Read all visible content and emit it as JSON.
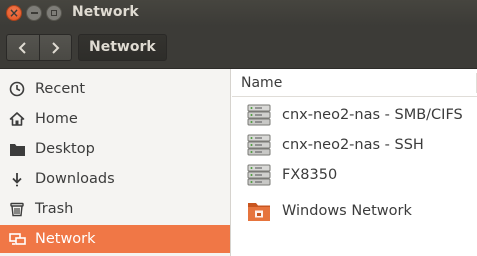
{
  "window": {
    "title": "Network"
  },
  "toolbar": {
    "path_label": "Network"
  },
  "sidebar": {
    "items": [
      {
        "label": "Recent",
        "icon": "clock-icon"
      },
      {
        "label": "Home",
        "icon": "home-icon"
      },
      {
        "label": "Desktop",
        "icon": "folder-icon"
      },
      {
        "label": "Downloads",
        "icon": "download-icon"
      },
      {
        "label": "Trash",
        "icon": "trash-icon"
      },
      {
        "label": "Network",
        "icon": "network-icon",
        "active": true
      }
    ]
  },
  "main": {
    "column_header": "Name",
    "items": [
      {
        "label": "cnx-neo2-nas - SMB/CIFS",
        "icon": "server-icon"
      },
      {
        "label": "cnx-neo2-nas - SSH",
        "icon": "server-icon"
      },
      {
        "label": "FX8350",
        "icon": "server-icon"
      },
      {
        "label": "Windows Network",
        "icon": "network-folder-icon"
      }
    ]
  },
  "colors": {
    "accent": "#f07746",
    "titlebar": "#3c3b37"
  }
}
